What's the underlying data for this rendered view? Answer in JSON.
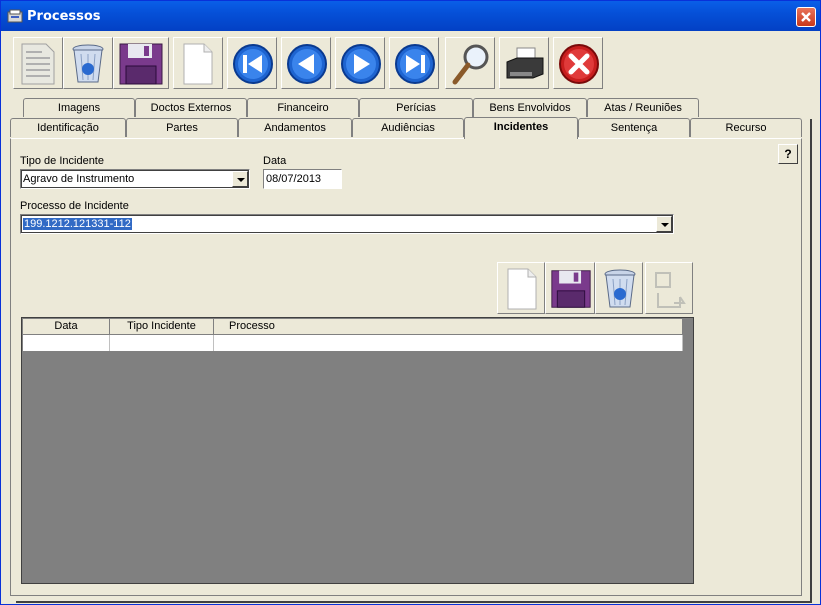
{
  "window": {
    "title": "Processos"
  },
  "toolbar": {
    "buttons": [
      "new-document-disabled",
      "delete",
      "save",
      "new",
      "first",
      "previous",
      "next",
      "last",
      "search",
      "print",
      "close"
    ]
  },
  "tabs_row1": [
    "Imagens",
    "Doctos Externos",
    "Financeiro",
    "Perícias",
    "Bens Envolvidos",
    "Atas / Reuniões"
  ],
  "tabs_row2": [
    "Identificação",
    "Partes",
    "Andamentos",
    "Audiências",
    "Incidentes",
    "Sentença",
    "Recurso"
  ],
  "active_tab": "Incidentes",
  "form": {
    "tipo_label": "Tipo de Incidente",
    "tipo_value": "Agravo de Instrumento",
    "data_label": "Data",
    "data_value": "08/07/2013",
    "processo_label": "Processo de Incidente",
    "processo_value": "199.1212.121331-112"
  },
  "help_label": "?",
  "grid": {
    "columns": [
      "Data",
      "Tipo Incidente",
      "Processo"
    ]
  }
}
